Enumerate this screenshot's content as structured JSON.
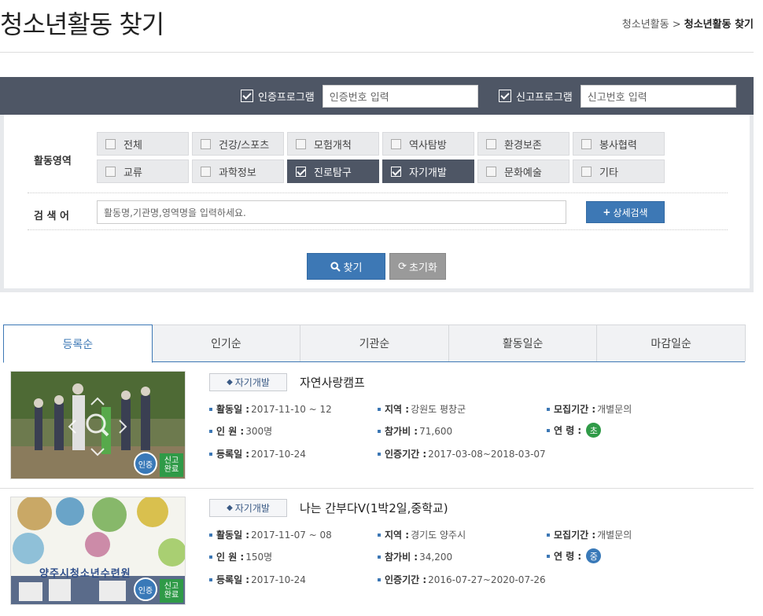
{
  "header": {
    "title": "청소년활동 찾기",
    "breadcrumb_parent": "청소년활동 >",
    "breadcrumb_current": "청소년활동 찾기"
  },
  "program_bar": {
    "cert_label": "인증프로그램",
    "cert_placeholder": "인증번호 입력",
    "report_label": "신고프로그램",
    "report_placeholder": "신고번호 입력"
  },
  "filter": {
    "area_label": "활동영역",
    "chips": [
      {
        "label": "전체",
        "checked": false
      },
      {
        "label": "건강/스포츠",
        "checked": false
      },
      {
        "label": "모험개척",
        "checked": false
      },
      {
        "label": "역사탐방",
        "checked": false
      },
      {
        "label": "환경보존",
        "checked": false
      },
      {
        "label": "봉사협력",
        "checked": false
      },
      {
        "label": "교류",
        "checked": false
      },
      {
        "label": "과학정보",
        "checked": false
      },
      {
        "label": "진로탐구",
        "checked": true
      },
      {
        "label": "자기개발",
        "checked": true
      },
      {
        "label": "문화예술",
        "checked": false
      },
      {
        "label": "기타",
        "checked": false
      }
    ],
    "keyword_label": "검 색 어",
    "keyword_placeholder": "활동명,기관명,영역명을 입력하세요.",
    "detail_button": "상세검색",
    "search_button": "찾기",
    "reset_button": "초기화"
  },
  "tabs": [
    "등록순",
    "인기순",
    "기관순",
    "활동일순",
    "마감일순"
  ],
  "results": [
    {
      "tag": "자기개발",
      "title": "자연사랑캠프",
      "activity_date_label": "활동일 :",
      "activity_date": "2017-11-10 ~ 12",
      "region_label": "지역 :",
      "region": "강원도 평창군",
      "recruit_label": "모집기간 :",
      "recruit": "개별문의",
      "people_label": "인 원 :",
      "people": "300명",
      "fee_label": "참가비 :",
      "fee": "71,600",
      "age_label": "연 령 :",
      "age": "초",
      "age_color": "#2f9a47",
      "reg_label": "등록일 :",
      "reg_date": "2017-10-24",
      "cert_period_label": "인증기간 :",
      "cert_period": "2017-03-08~2018-03-07",
      "badge_cert": "인증",
      "badge_done": "신고 완료"
    },
    {
      "tag": "자기개발",
      "title": "나는 간부다Ⅴ(1박2일,중학교)",
      "activity_date_label": "활동일 :",
      "activity_date": "2017-11-07 ~ 08",
      "region_label": "지역 :",
      "region": "경기도 양주시",
      "recruit_label": "모집기간 :",
      "recruit": "개별문의",
      "people_label": "인 원 :",
      "people": "150명",
      "fee_label": "참가비 :",
      "fee": "34,200",
      "age_label": "연 령 :",
      "age": "중",
      "age_color": "#3979b8",
      "reg_label": "등록일 :",
      "reg_date": "2017-10-24",
      "cert_period_label": "인증기간 :",
      "cert_period": "2016-07-27~2020-07-26",
      "badge_cert": "인증",
      "badge_done": "신고 완료",
      "banner_text": "양주시청소년수련원"
    }
  ]
}
